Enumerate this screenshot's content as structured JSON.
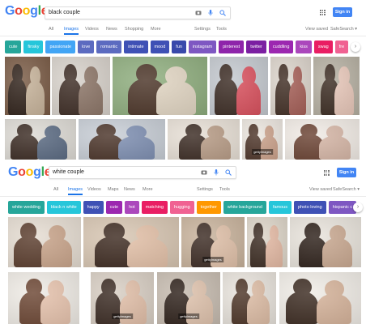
{
  "brand": {
    "logo_letters": [
      "G",
      "o",
      "o",
      "g",
      "l",
      "e"
    ],
    "logo_colors": [
      "#4285f4",
      "#ea4335",
      "#fbbc05",
      "#4285f4",
      "#34a853",
      "#ea4335"
    ]
  },
  "panels": [
    {
      "query": "black couple",
      "tabs": [
        "All",
        "Images",
        "Videos",
        "News",
        "Shopping",
        "More"
      ],
      "active_tab": "Images",
      "right_tabs": [
        "Settings",
        "Tools"
      ],
      "view_saved": "View saved",
      "safesearch": "SafeSearch ▾",
      "signin": "Sign in",
      "chips": [
        {
          "label": "cute",
          "color": "#26a69a"
        },
        {
          "label": "finsky",
          "color": "#26c6da"
        },
        {
          "label": "passionate",
          "color": "#42a5f5"
        },
        {
          "label": "love",
          "color": "#5c6bc0"
        },
        {
          "label": "romantic",
          "color": "#5c6bc0"
        },
        {
          "label": "intimate",
          "color": "#3f51b5"
        },
        {
          "label": "mood",
          "color": "#3f51b5"
        },
        {
          "label": "fun",
          "color": "#3949ab"
        },
        {
          "label": "instagram",
          "color": "#7e57c2"
        },
        {
          "label": "pinterest",
          "color": "#8e24aa"
        },
        {
          "label": "twitter",
          "color": "#7b1fa2"
        },
        {
          "label": "cuddling",
          "color": "#9c27b0"
        },
        {
          "label": "kiss",
          "color": "#ab47bc"
        },
        {
          "label": "swag",
          "color": "#e91e63"
        },
        {
          "label": "fre",
          "color": "#f06292"
        }
      ],
      "images": [
        {
          "colors": [
            "#7a5b45",
            "#2e2018",
            "#c7b39a"
          ]
        },
        {
          "colors": [
            "#d8d2cb",
            "#3b2a22",
            "#8c7567"
          ]
        },
        {
          "colors": [
            "#8fae7e",
            "#4a3326",
            "#e2d6c3"
          ]
        },
        {
          "colors": [
            "#c4c9cf",
            "#3a2a22",
            "#d94f5c"
          ]
        },
        {
          "colors": [
            "#dcd4cb",
            "#3f2c22",
            "#a45d55"
          ]
        },
        {
          "colors": [
            "#b6b0a2",
            "#3a2a20",
            "#e7c6b8"
          ]
        },
        {
          "colors": [
            "#dedbd5",
            "#3a2a22",
            "#5a6a82"
          ]
        },
        {
          "colors": [
            "#c8ced6",
            "#4a3328",
            "#7e8fb2"
          ]
        },
        {
          "colors": [
            "#e8e0d6",
            "#3a2a22",
            "#b89c86"
          ]
        },
        {
          "colors": [
            "#ece6df",
            "#4c3327",
            "#caa089"
          ],
          "watermark": "gettyimages"
        },
        {
          "colors": [
            "#f2ece6",
            "#6a4232",
            "#d6b6a6"
          ]
        },
        {
          "colors": [
            "#a9c18d",
            "#3c2a20",
            "#d77b78"
          ]
        }
      ]
    },
    {
      "query": "white couple",
      "tabs": [
        "All",
        "Images",
        "Videos",
        "Maps",
        "News",
        "More"
      ],
      "active_tab": "Images",
      "right_tabs": [
        "Settings",
        "Tools"
      ],
      "view_saved": "View saved",
      "safesearch": "SafeSearch ▾",
      "signin": "Sign in",
      "chips": [
        {
          "label": "white wedding",
          "color": "#26a69a"
        },
        {
          "label": "black n white",
          "color": "#26c6da"
        },
        {
          "label": "happy",
          "color": "#3f51b5"
        },
        {
          "label": "cute",
          "color": "#9c27b0"
        },
        {
          "label": "hot",
          "color": "#ab47bc"
        },
        {
          "label": "matching",
          "color": "#e91e63"
        },
        {
          "label": "hugging",
          "color": "#f06292"
        },
        {
          "label": "together",
          "color": "#ff9800"
        },
        {
          "label": "white background",
          "color": "#26a69a"
        },
        {
          "label": "famous",
          "color": "#26c6da"
        },
        {
          "label": "photo loving",
          "color": "#3f51b5"
        },
        {
          "label": "hispanic c",
          "color": "#7e57c2"
        }
      ],
      "images": [
        {
          "colors": [
            "#e6ddd2",
            "#5a3c2c",
            "#c9a48a"
          ]
        },
        {
          "colors": [
            "#d8c6b2",
            "#3d2a20",
            "#e4c1a8"
          ]
        },
        {
          "colors": [
            "#c9b39c",
            "#3b2a22",
            "#e0c0a8"
          ],
          "watermark": "gettyimages"
        },
        {
          "colors": [
            "#ddd5c8",
            "#3a2a20",
            "#e3b8a2"
          ]
        },
        {
          "colors": [
            "#e9e4dc",
            "#2c1f18",
            "#c9a890"
          ]
        },
        {
          "colors": [
            "#f0ece6",
            "#6b4532",
            "#e7c3ad"
          ]
        },
        {
          "colors": [
            "#d9cfc4",
            "#3a2a22",
            "#e2bfa8"
          ],
          "watermark": "gettyimages"
        },
        {
          "colors": [
            "#c7bcb0",
            "#2d2019",
            "#e0c3ad"
          ],
          "watermark": "gettyimages"
        },
        {
          "colors": [
            "#e8e3dc",
            "#4b3325",
            "#ddbca4"
          ]
        },
        {
          "colors": [
            "#f1ede7",
            "#3b2a20",
            "#d6b39a"
          ]
        }
      ]
    }
  ]
}
